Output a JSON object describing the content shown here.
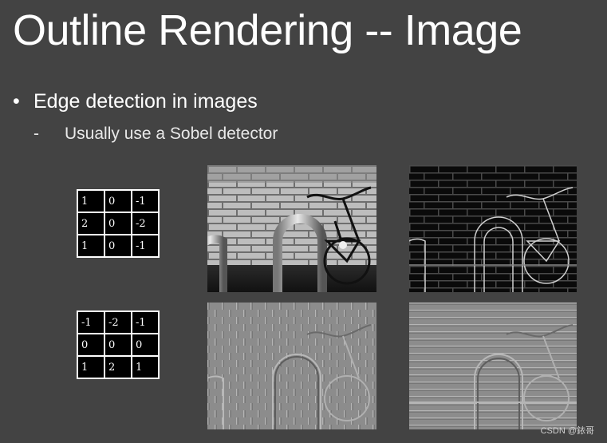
{
  "title": "Outline Rendering -- Image",
  "bullet": {
    "marker": "•",
    "text": "Edge detection in images"
  },
  "sub_bullet": {
    "marker": "-",
    "text": "Usually use a Sobel detector"
  },
  "kernel_x": [
    [
      "1",
      "0",
      "-1"
    ],
    [
      "2",
      "0",
      "-2"
    ],
    [
      "1",
      "0",
      "-1"
    ]
  ],
  "kernel_y": [
    [
      "-1",
      "-2",
      "-1"
    ],
    [
      "0",
      "0",
      "0"
    ],
    [
      "1",
      "2",
      "1"
    ]
  ],
  "images": {
    "original": "bicycle-photo",
    "magnitude": "edge-magnitude-image",
    "gradient_x": "horizontal-gradient-image",
    "gradient_y": "vertical-gradient-image"
  },
  "watermark": "CSDN @銥哥"
}
